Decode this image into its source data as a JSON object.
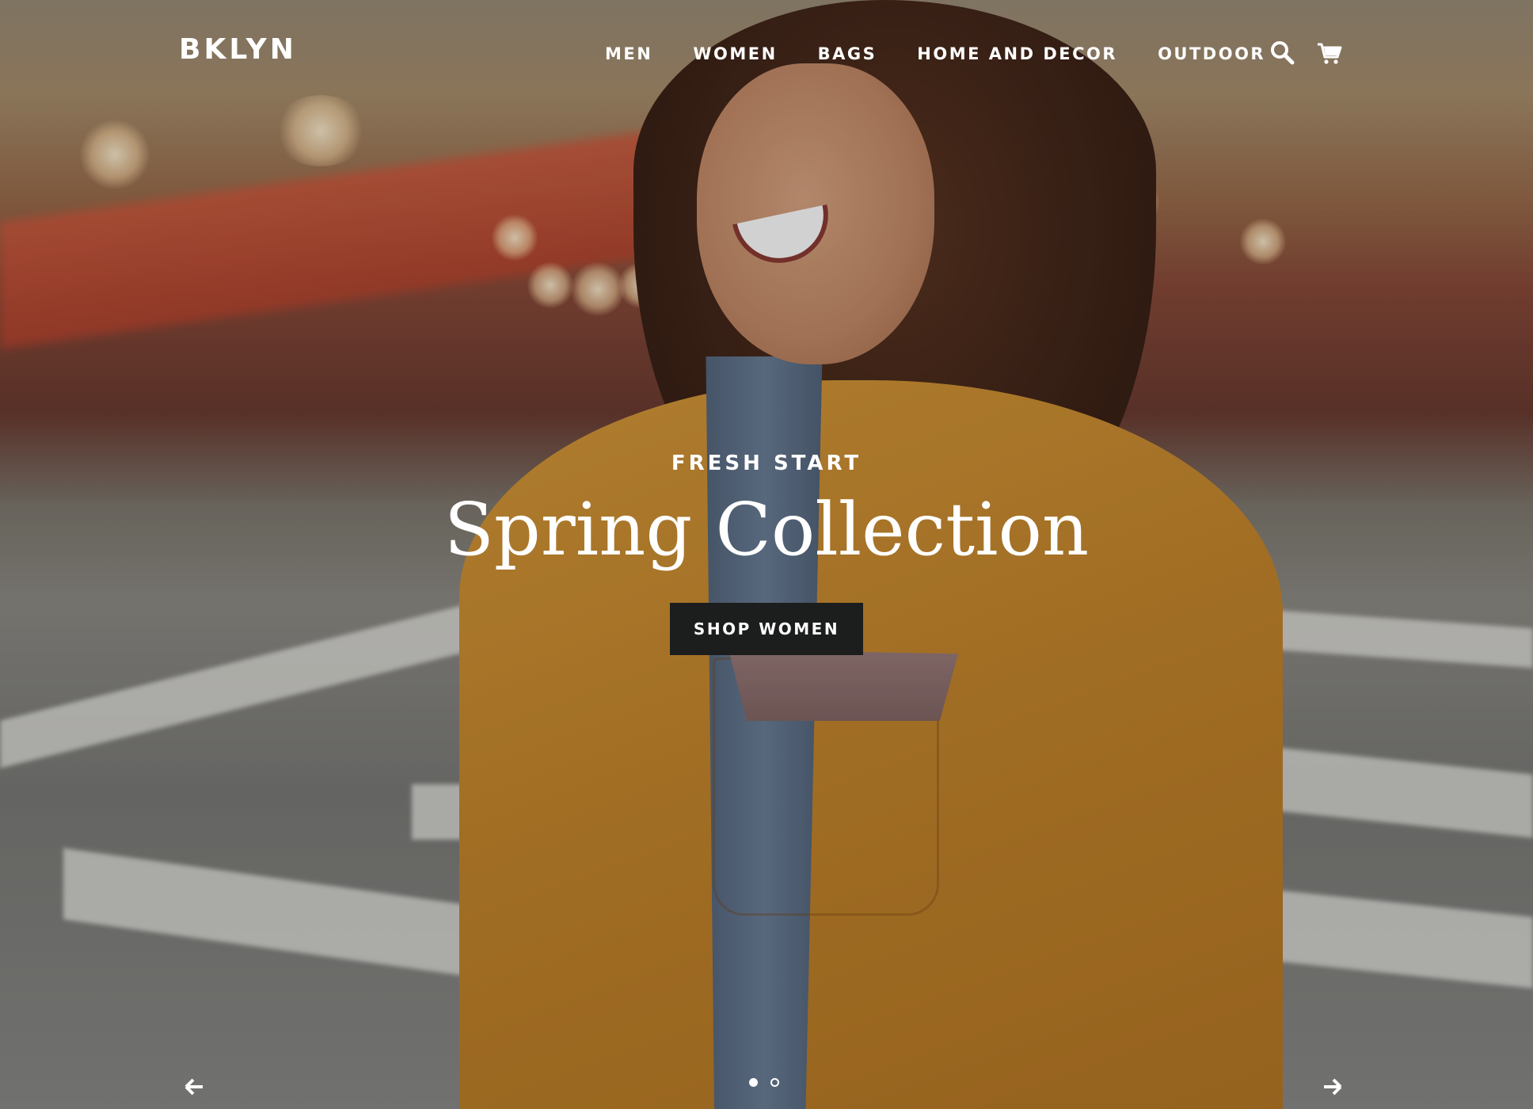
{
  "header": {
    "logo": "BKLYN",
    "nav": [
      "MEN",
      "WOMEN",
      "BAGS",
      "HOME AND DECOR",
      "OUTDOOR"
    ],
    "search_icon": "search-icon",
    "cart_icon": "cart-icon"
  },
  "slide": {
    "subheading": "FRESH START",
    "title": "Spring Collection",
    "button_label": "SHOP WOMEN"
  },
  "slideshow": {
    "prev_icon": "arrow-left-icon",
    "next_icon": "arrow-right-icon",
    "total_slides": 2,
    "active_slide": 1
  },
  "colors": {
    "text": "#ffffff",
    "button_bg": "#1c1d1d"
  }
}
